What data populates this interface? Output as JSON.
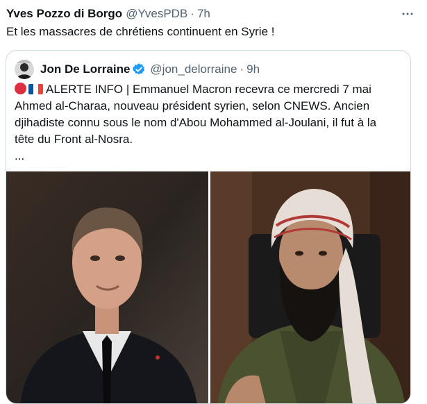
{
  "tweet": {
    "author_name": "Yves Pozzo di Borgo",
    "handle": "@YvesPDB",
    "separator": "·",
    "time": "7h",
    "text": "Et les massacres de chrétiens continuent en Syrie !",
    "more_icon": "more-horizontal-icon"
  },
  "quote": {
    "author_name": "Jon De Lorraine",
    "verified_icon": "verified-badge-icon",
    "handle": "@jon_delorraine",
    "separator": "·",
    "time": "9h",
    "lines": [
      "ALERTE INFO | Emmanuel Macron recevra ce mercredi 7 mai",
      "Ahmed al-Charaa, nouveau président syrien, selon CNEWS. Ancien",
      "djihadiste connu sous le nom d'Abou Mohammed al-Joulani, il fut à la",
      "tête du Front al-Nosra.",
      "..."
    ],
    "emojis": [
      "red-circle",
      "flag-france"
    ]
  },
  "colors": {
    "text_primary": "#0f1419",
    "text_secondary": "#536471",
    "border": "#cfd9de",
    "verified_blue": "#1d9bf0"
  }
}
